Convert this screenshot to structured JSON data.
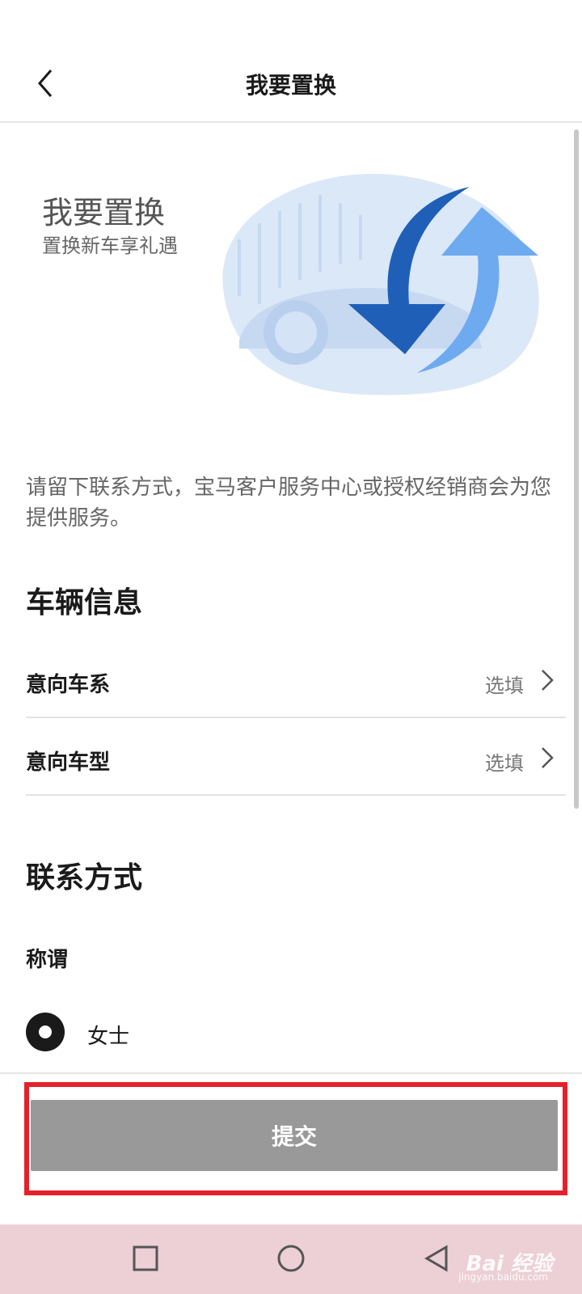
{
  "header": {
    "title": "我要置换",
    "back_icon": "chevron-left-icon"
  },
  "hero": {
    "title": "我要置换",
    "subtitle": "置换新车享礼遇",
    "illustration": "car-exchange-arrows-illustration"
  },
  "intro": "请留下联系方式，宝马客户服务中心或授权经销商会为您提供服务。",
  "vehicle_section": {
    "title": "车辆信息",
    "rows": [
      {
        "label": "意向车系",
        "value": "选填"
      },
      {
        "label": "意向车型",
        "value": "选填"
      }
    ]
  },
  "contact_section": {
    "title": "联系方式",
    "salutation_label": "称谓",
    "options": [
      {
        "label": "女士",
        "selected": true
      }
    ]
  },
  "footer": {
    "submit_label": "提交",
    "highlight_color": "#e5202a"
  },
  "navbar": {
    "buttons": [
      "recent-apps-icon",
      "home-icon",
      "back-icon"
    ],
    "watermark": "Bai 经验",
    "watermark_sub": "jingyan.baidu.com"
  },
  "colors": {
    "accent_blue": "#1f5fb8",
    "submit_bg": "#999999",
    "navbar_bg": "#ecd0d6"
  }
}
